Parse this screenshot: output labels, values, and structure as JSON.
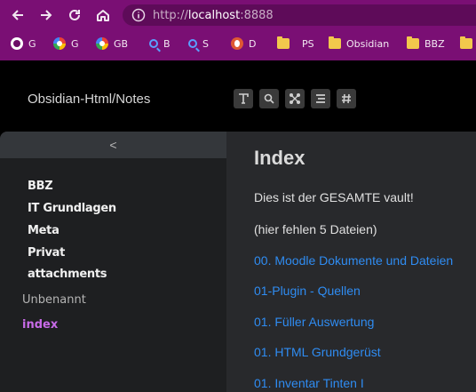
{
  "browser": {
    "url_scheme": "http://",
    "url_host": "localhost",
    "url_port": ":8888",
    "bookmarks": [
      {
        "icon": "github-icon",
        "label": "G"
      },
      {
        "icon": "google-icon",
        "label": "G"
      },
      {
        "icon": "google-icon",
        "label": "GB"
      },
      {
        "icon": "search-icon",
        "label": "B"
      },
      {
        "icon": "search-icon",
        "label": "S"
      },
      {
        "icon": "duckduckgo-icon",
        "label": "D"
      },
      {
        "icon": "folder-icon",
        "label": ""
      },
      {
        "icon": "folder-icon",
        "label": "PS"
      },
      {
        "icon": "folder-icon",
        "label": "Obsidian"
      },
      {
        "icon": "folder-icon",
        "label": "BBZ"
      },
      {
        "icon": "folder-icon",
        "label": ""
      }
    ]
  },
  "site": {
    "title": "Obsidian-Html/Notes",
    "tools": [
      "text-icon",
      "search-icon",
      "graph-icon",
      "list-icon",
      "hashtag-icon"
    ]
  },
  "sidebar": {
    "collapse_label": "<",
    "folders": [
      "BBZ",
      "IT Grundlagen",
      "Meta",
      "Privat",
      "attachments"
    ],
    "notes": [
      {
        "label": "Unbenannt",
        "active": false
      },
      {
        "label": "index",
        "active": true
      }
    ]
  },
  "main": {
    "title": "Index",
    "paragraphs": [
      "Dies ist der GESAMTE vault!",
      "(hier fehlen 5 Dateien)"
    ],
    "links": [
      "00. Moodle Dokumente und Dateien",
      "01-Plugin - Quellen",
      "01. Füller Auswertung",
      "01. HTML Grundgerüst",
      "01. Inventar Tinten I"
    ]
  },
  "colors": {
    "chrome": "#7a0f74",
    "link": "#2f8cf2",
    "active_note": "#c86be8",
    "sidebar_bg": "#1e1f21",
    "main_bg": "#28292c"
  }
}
